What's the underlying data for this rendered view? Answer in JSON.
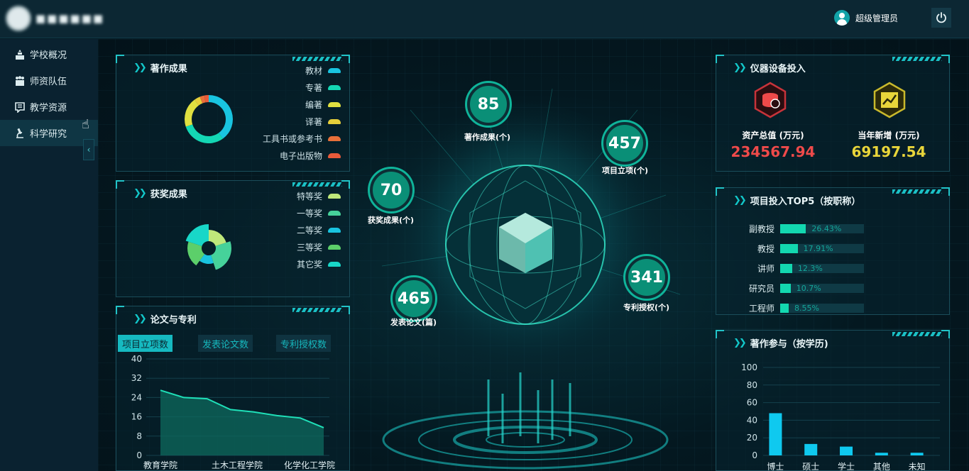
{
  "header": {
    "user_name": "超级管理员"
  },
  "sidebar": {
    "items": [
      {
        "label": "学校概况"
      },
      {
        "label": "师资队伍"
      },
      {
        "label": "教学资源"
      },
      {
        "label": "科学研究"
      }
    ]
  },
  "works": {
    "title": "著作成果",
    "legend": [
      "教材",
      "专著",
      "编著",
      "译著",
      "工具书或参考书",
      "电子出版物"
    ],
    "colors": [
      "#19c4e0",
      "#14d7b4",
      "#e0e040",
      "#e6cf3a",
      "#e8703a",
      "#e85a3a"
    ],
    "values": [
      40,
      30,
      20,
      4,
      3,
      3
    ]
  },
  "awards": {
    "title": "获奖成果",
    "legend": [
      "特等奖",
      "一等奖",
      "二等奖",
      "三等奖",
      "其它奖"
    ],
    "colors": [
      "#bfe87a",
      "#46d29a",
      "#19c4e0",
      "#5ccf6a",
      "#18d7c8"
    ],
    "values": [
      20,
      25,
      15,
      20,
      20
    ]
  },
  "papers": {
    "title": "论文与专利",
    "tabs": [
      "项目立项数",
      "发表论文数",
      "专利授权数"
    ],
    "chart_data": {
      "type": "area",
      "categories": [
        "教育学院",
        "土木工程学院",
        "化学化工学院"
      ],
      "x_points": 8,
      "values": [
        27,
        24,
        23.5,
        19,
        18,
        16.5,
        15.5,
        11.5
      ],
      "ylim": [
        0,
        40
      ],
      "yticks": [
        "40",
        "32",
        "24",
        "16",
        "8",
        "0"
      ]
    }
  },
  "center": {
    "bubbles": [
      {
        "value": "85",
        "label": "著作成果(个)"
      },
      {
        "value": "457",
        "label": "项目立项(个)"
      },
      {
        "value": "70",
        "label": "获奖成果(个)"
      },
      {
        "value": "341",
        "label": "专利授权(个)"
      },
      {
        "value": "465",
        "label": "发表论文(篇)"
      }
    ]
  },
  "equipment": {
    "title": "仪器设备投入",
    "total_label": "资产总值 (万元)",
    "total_value": "234567.94",
    "new_label": "当年新增 (万元)",
    "new_value": "69197.54",
    "total_color": "#ef4a4a",
    "new_color": "#e8d53a"
  },
  "projects": {
    "title": "项目投入TOP5（按职称）",
    "chart_data": {
      "type": "bar",
      "categories": [
        "副教授",
        "教授",
        "讲师",
        "研究员",
        "工程师"
      ],
      "values": [
        26.43,
        17.91,
        12.3,
        10.7,
        8.55
      ],
      "labels": [
        "26.43%",
        "17.91%",
        "12.3%",
        "10.7%",
        "8.55%"
      ]
    }
  },
  "participation": {
    "title": "著作参与（按学历)",
    "chart_data": {
      "type": "bar",
      "categories": [
        "博士",
        "硕士",
        "学士",
        "其他",
        "未知"
      ],
      "values": [
        48,
        13,
        10,
        3,
        3
      ],
      "ylim": [
        0,
        100
      ],
      "yticks": [
        "100",
        "80",
        "60",
        "40",
        "20",
        "0"
      ]
    }
  }
}
